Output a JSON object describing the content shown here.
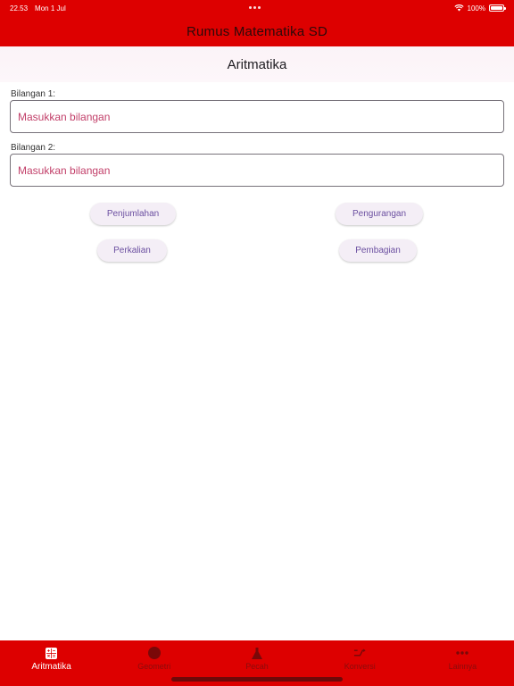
{
  "status_bar": {
    "time": "22.53",
    "date": "Mon 1 Jul",
    "battery": "100%",
    "battery_level": 1.0
  },
  "app_bar": {
    "title": "Rumus Matematika SD"
  },
  "section": {
    "title": "Aritmatika"
  },
  "form": {
    "field1": {
      "label": "Bilangan 1:",
      "placeholder": "Masukkan bilangan",
      "value": ""
    },
    "field2": {
      "label": "Bilangan 2:",
      "placeholder": "Masukkan bilangan",
      "value": ""
    }
  },
  "buttons": {
    "penjumlahan": "Penjumlahan",
    "pengurangan": "Pengurangan",
    "perkalian": "Perkalian",
    "pembagian": "Pembagian"
  },
  "bottom_nav": {
    "items": [
      {
        "label": "Aritmatika",
        "icon": "calculator-icon",
        "active": true
      },
      {
        "label": "Geometri",
        "icon": "circle-icon",
        "active": false
      },
      {
        "label": "Pecah",
        "icon": "flask-icon",
        "active": false
      },
      {
        "label": "Konversi",
        "icon": "swap-icon",
        "active": false
      },
      {
        "label": "Lainnya",
        "icon": "more-icon",
        "active": false
      }
    ]
  },
  "colors": {
    "primary": "#dd0000",
    "placeholder": "#c2406a",
    "button_bg": "#f4eef6",
    "button_text": "#6b4fa0",
    "inactive_nav": "#8a0c0c"
  }
}
